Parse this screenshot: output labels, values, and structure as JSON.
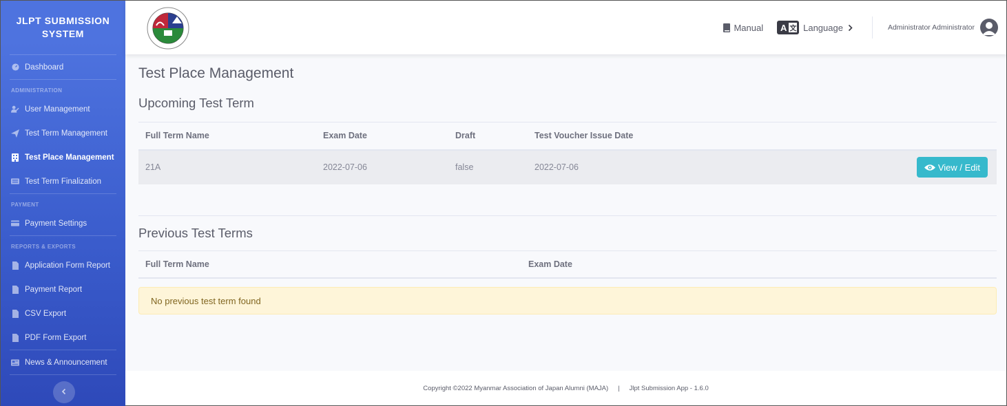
{
  "sidebar": {
    "brand": "JLPT SUBMISSION SYSTEM",
    "dashboard": "Dashboard",
    "sections": {
      "administration": "ADMINISTRATION",
      "payment": "PAYMENT",
      "reports": "REPORTS & EXPORTS"
    },
    "items": {
      "user_management": "User Management",
      "test_term_management": "Test Term Management",
      "test_place_management": "Test Place Management",
      "test_term_finalization": "Test Term Finalization",
      "payment_settings": "Payment Settings",
      "application_form_report": "Application Form Report",
      "payment_report": "Payment Report",
      "csv_export": "CSV Export",
      "pdf_form_export": "PDF Form Export",
      "news_announcement": "News & Announcement"
    }
  },
  "topbar": {
    "manual": "Manual",
    "language": "Language",
    "user_name": "Administrator Administrator"
  },
  "page": {
    "title": "Test Place Management",
    "upcoming": {
      "title": "Upcoming Test Term",
      "headers": [
        "Full Term Name",
        "Exam Date",
        "Draft",
        "Test Voucher Issue Date"
      ],
      "rows": [
        {
          "full_term_name": "21A",
          "exam_date": "2022-07-06",
          "draft": "false",
          "voucher_date": "2022-07-06",
          "action": "View / Edit"
        }
      ]
    },
    "previous": {
      "title": "Previous Test Terms",
      "headers": [
        "Full Term Name",
        "Exam Date"
      ],
      "empty_message": "No previous test term found"
    }
  },
  "footer": {
    "copyright": "Copyright ©2022 Myanmar Association of Japan Alumni (MAJA)",
    "separator": "|",
    "version": "Jlpt Submission App - 1.6.0"
  },
  "colors": {
    "sidebar": "#4e73df",
    "info_button": "#36b9cc",
    "alert_bg": "#fef5d9"
  }
}
